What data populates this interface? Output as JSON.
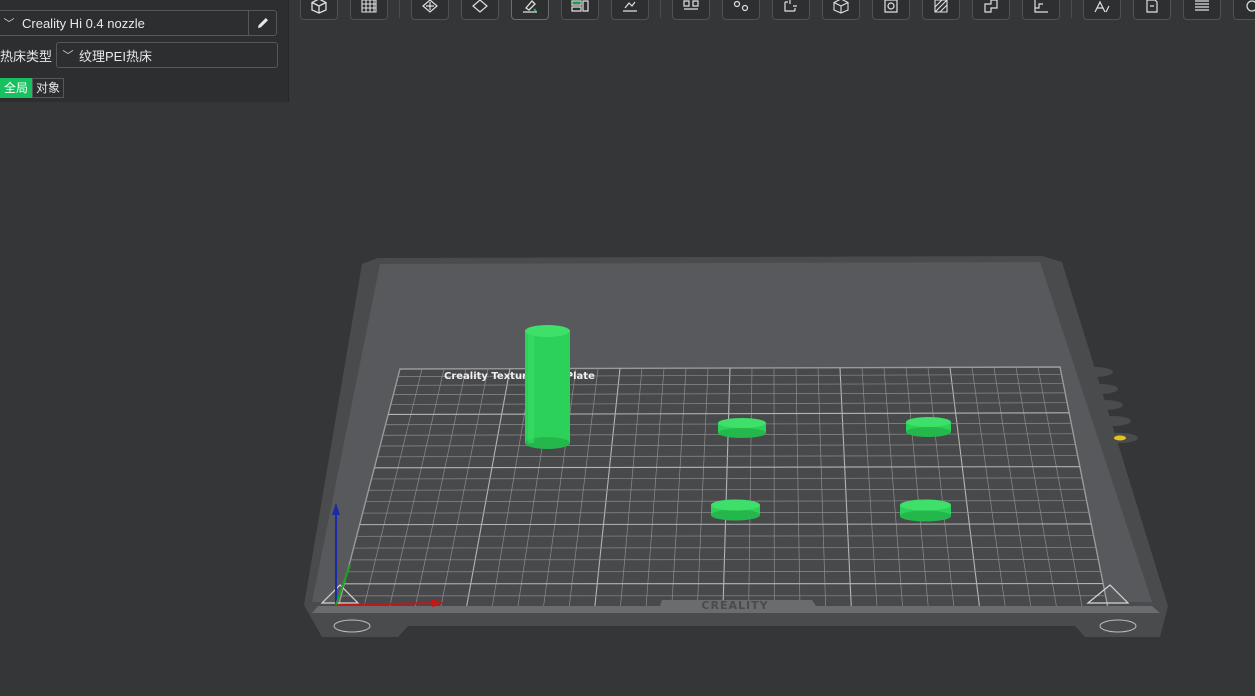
{
  "printer": {
    "name": "Creality Hi 0.4 nozzle"
  },
  "bed": {
    "label": "热床类型",
    "value": "纹理PEI热床"
  },
  "scope": {
    "global": "全局",
    "object": "对象"
  },
  "plate": {
    "title": "Creality Textured PEI Plate",
    "brand": "CREALITY"
  },
  "toolbar": {
    "icons": [
      "add-cube-icon",
      "grid-arrange-icon",
      "orient-icon",
      "auto-orient-icon",
      "paint-icon",
      "layout-icon",
      "split-icon",
      "align-icon",
      "scale-icon",
      "cut-icon",
      "mesh-icon",
      "support-icon",
      "seam-icon",
      "measure-icon",
      "assembly-icon",
      "text-icon",
      "slice-view-icon",
      "variable-layer-icon",
      "list-icon",
      "more-icon"
    ]
  },
  "colors": {
    "accent": "#17c25e",
    "model": "#2bd158",
    "background": "#353638"
  }
}
